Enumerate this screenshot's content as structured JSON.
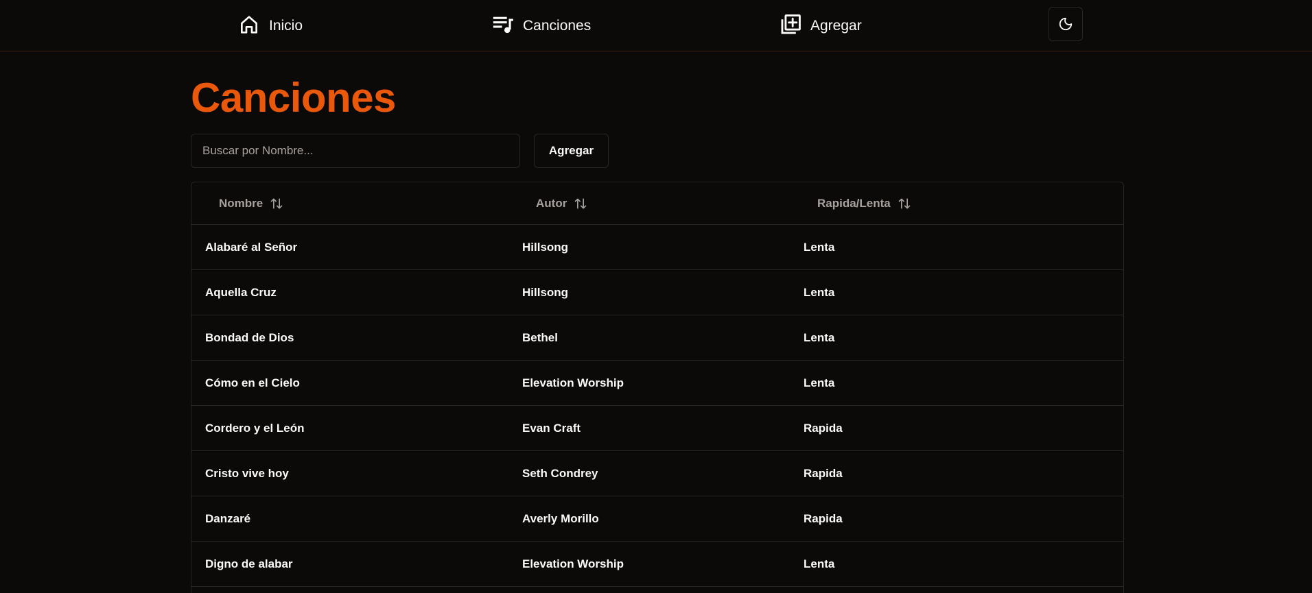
{
  "nav": {
    "items": [
      {
        "label": "Inicio",
        "icon": "home-icon"
      },
      {
        "label": "Canciones",
        "icon": "music-list-icon"
      },
      {
        "label": "Agregar",
        "icon": "add-library-icon"
      }
    ],
    "theme_toggle_icon": "moon-icon"
  },
  "main": {
    "title": "Canciones",
    "search": {
      "placeholder": "Buscar por Nombre...",
      "value": ""
    },
    "add_button_label": "Agregar"
  },
  "table": {
    "columns": [
      "Nombre",
      "Autor",
      "Rapida/Lenta"
    ],
    "rows": [
      {
        "nombre": "Alabaré al Señor",
        "autor": "Hillsong",
        "tipo": "Lenta"
      },
      {
        "nombre": "Aquella Cruz",
        "autor": "Hillsong",
        "tipo": "Lenta"
      },
      {
        "nombre": "Bondad de Dios",
        "autor": "Bethel",
        "tipo": "Lenta"
      },
      {
        "nombre": "Cómo en el Cielo",
        "autor": "Elevation Worship",
        "tipo": "Lenta"
      },
      {
        "nombre": "Cordero y el León",
        "autor": "Evan Craft",
        "tipo": "Rapida"
      },
      {
        "nombre": "Cristo vive hoy",
        "autor": "Seth Condrey",
        "tipo": "Rapida"
      },
      {
        "nombre": "Danzaré",
        "autor": "Averly Morillo",
        "tipo": "Rapida"
      },
      {
        "nombre": "Digno de alabar",
        "autor": "Elevation Worship",
        "tipo": "Lenta"
      }
    ]
  },
  "colors": {
    "background": "#0c0a09",
    "accent": "#ea580c",
    "border": "#292524",
    "text": "#fafaf9",
    "muted": "#a8a29e"
  }
}
